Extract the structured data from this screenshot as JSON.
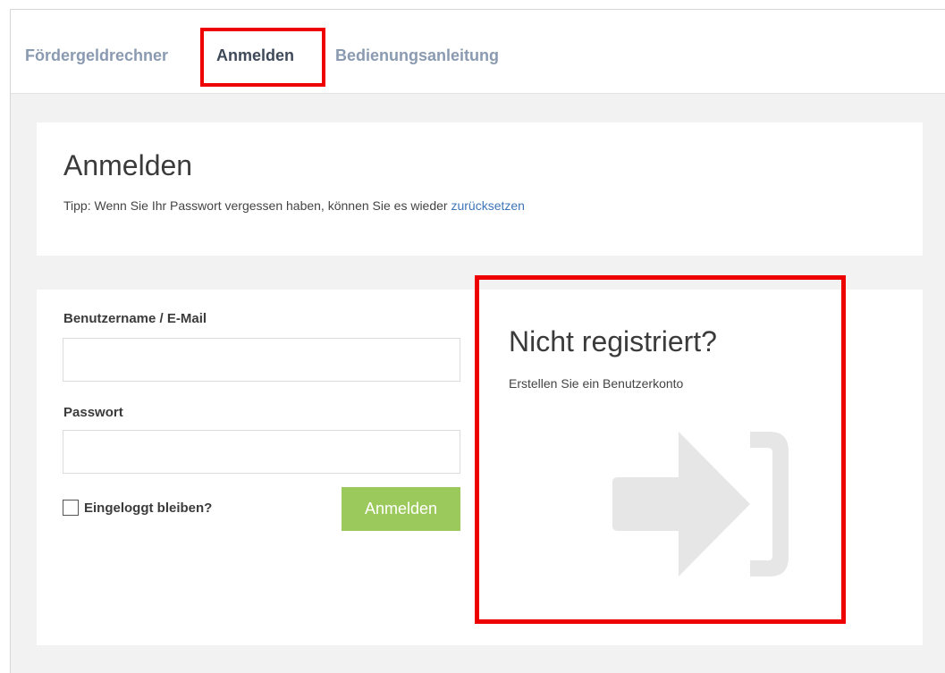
{
  "nav": {
    "items": [
      {
        "label": "Fördergeldrechner"
      },
      {
        "label": "Anmelden"
      },
      {
        "label": "Bedienungsanleitung"
      }
    ],
    "active": "Anmelden"
  },
  "intro": {
    "title": "Anmelden",
    "tip_text": "Tipp: Wenn Sie Ihr Passwort vergessen haben, können Sie es wieder ",
    "tip_link": "zurücksetzen"
  },
  "login": {
    "username_label": "Benutzername / E-Mail",
    "username_value": "",
    "password_label": "Passwort",
    "password_value": "",
    "remember_label": "Eingeloggt bleiben?",
    "remember_checked": false,
    "submit_label": "Anmelden"
  },
  "register": {
    "title": "Nicht registriert?",
    "subtitle": "Erstellen Sie ein Benutzerkonto",
    "icon": "sign-in-icon"
  },
  "colors": {
    "nav_inactive": "#8a9ab0",
    "nav_active": "#3e4a59",
    "link": "#3d75b8",
    "button": "#9cc95c",
    "icon": "#e6e6e6",
    "highlight": "#ee0000"
  }
}
